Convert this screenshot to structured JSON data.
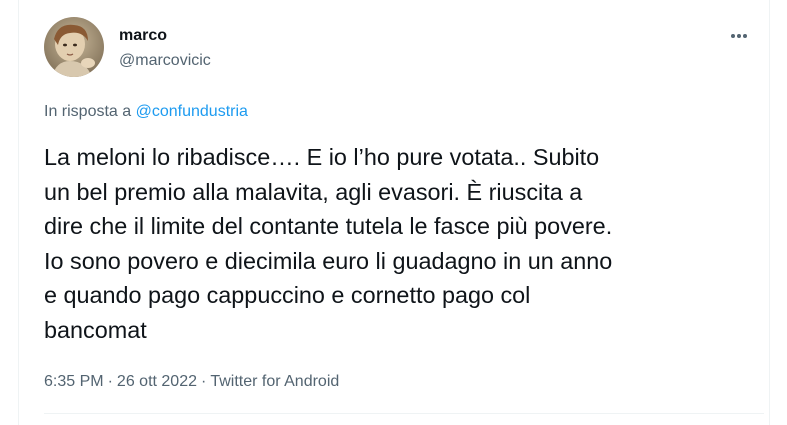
{
  "tweet": {
    "display_name": "marco",
    "handle": "@marcovicic",
    "avatar_icon": "user-avatar-photo",
    "more_icon": "more-options-icon",
    "reply_prefix": "In risposta a ",
    "reply_to": "@confundustria",
    "text": "La meloni lo ribadisce…. E io  l’ho  pure votata.. Subito\nun bel premio alla malavita, agli evasori.  È  riuscita a\ndire che  il limite del contante tutela le fasce più povere.\nIo sono povero e diecimila euro li guadagno in un anno\ne quando pago cappuccino e cornetto pago col\nbancomat",
    "time": "6:35 PM",
    "date": "26 ott 2022",
    "separator": "·",
    "source": "Twitter for Android"
  },
  "colors": {
    "text": "#0f1419",
    "secondary": "#536471",
    "link": "#1d9bf0",
    "border": "#eff3f4"
  }
}
